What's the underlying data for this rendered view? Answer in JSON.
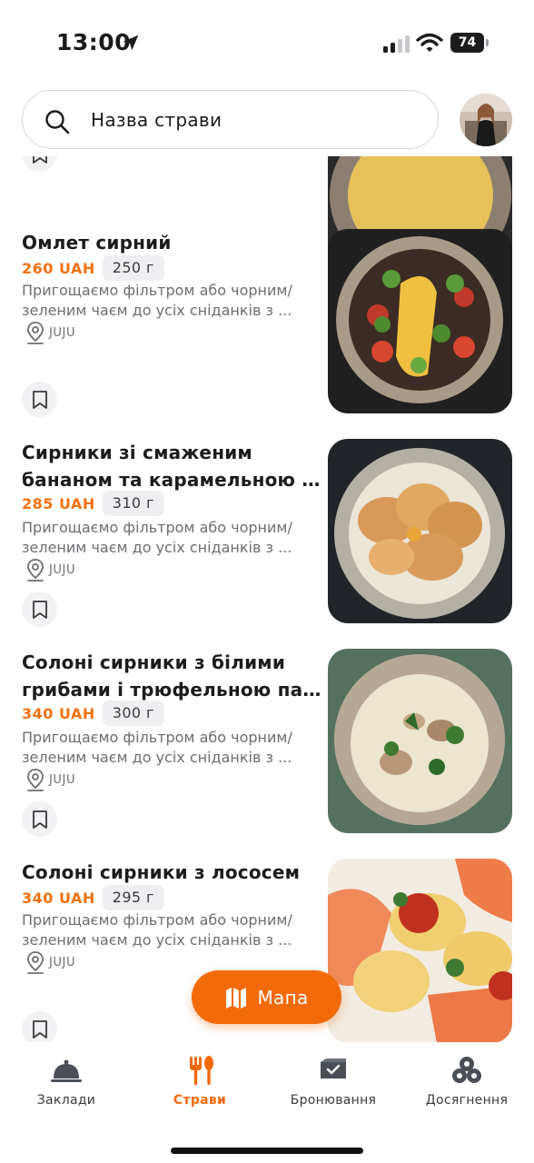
{
  "status_bar": {
    "time": "13:00",
    "battery": "74"
  },
  "search": {
    "placeholder": "Назва страви"
  },
  "dishes": [
    {
      "title": "Омлет сирний",
      "price": "260 UAH",
      "weight": "250 г",
      "desc_line1": "Пригощаємо фільтром або чорним/",
      "desc_line2": "зеленим чаєм до усіх сніданків з ...",
      "venue": "JUJU"
    },
    {
      "title_line1": "Сирники зі смаженим",
      "title_line2": "бананом та карамельною пі...",
      "price": "285 UAH",
      "weight": "310 г",
      "desc_line1": "Пригощаємо фільтром або чорним/",
      "desc_line2": "зеленим чаєм до усіх сніданків з ...",
      "venue": "JUJU"
    },
    {
      "title_line1": "Солоні сирники з білими",
      "title_line2": "грибами і трюфельною паст...",
      "price": "340 UAH",
      "weight": "300 г",
      "desc_line1": "Пригощаємо фільтром або чорним/",
      "desc_line2": "зеленим чаєм до усіх сніданків з ...",
      "venue": "JUJU"
    },
    {
      "title": "Солоні сирники з лососем",
      "price": "340 UAH",
      "weight": "295 г",
      "desc_line1": "Пригощаємо фільтром або чорним/",
      "desc_line2": "зеленим чаєм до усіх сніданків з ...",
      "venue": "JUJU"
    }
  ],
  "map_button": {
    "label": "Мапа"
  },
  "tabs": [
    {
      "label": "Заклади",
      "icon": "cloche-icon",
      "active": false
    },
    {
      "label": "Страви",
      "icon": "fork-knife-icon",
      "active": true
    },
    {
      "label": "Бронювання",
      "icon": "booking-icon",
      "active": false
    },
    {
      "label": "Досягнення",
      "icon": "achievements-icon",
      "active": false
    }
  ],
  "colors": {
    "accent": "#f36a08",
    "price": "#f0720f",
    "text": "#1c1c1e",
    "muted": "#6d6d72"
  }
}
